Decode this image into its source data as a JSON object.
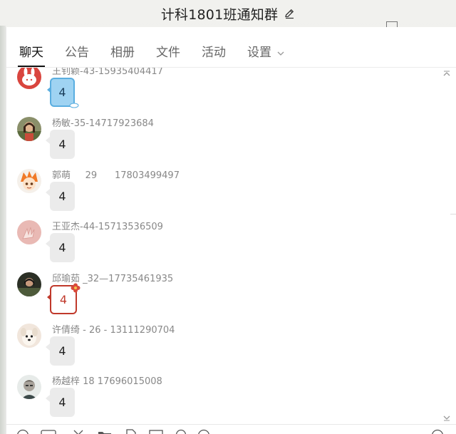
{
  "window": {
    "title": "计科1801班通知群"
  },
  "tabs": [
    {
      "label": "聊天",
      "active": true
    },
    {
      "label": "公告"
    },
    {
      "label": "相册"
    },
    {
      "label": "文件"
    },
    {
      "label": "活动"
    },
    {
      "label": "设置"
    }
  ],
  "messages": [
    {
      "sender": "王钊颖-43-15935404417",
      "text": "4"
    },
    {
      "sender": "杨敏-35-14717923684",
      "text": "4"
    },
    {
      "sender": "郭萌     29      17803499497",
      "text": "4"
    },
    {
      "sender": "王亚杰-44-15713536509",
      "text": "4"
    },
    {
      "sender": "邱瑜茹 _32—17735461935",
      "text": "4"
    },
    {
      "sender": "许倩绮 - 26 - 13111290704",
      "text": "4"
    },
    {
      "sender": "杨越梓 18 17696015008",
      "text": "4"
    }
  ],
  "colors": {
    "accent_blue": "#5aaee0",
    "accent_red": "#c0392b",
    "bubble_grey": "#ebebeb"
  },
  "icons": {
    "title_edit": "pencil-icon",
    "settings_chevron": "chevron-down-icon",
    "scroll_up": "chevron-up-icon",
    "scroll_down": "chevron-down-icon",
    "toolbar": [
      "emoji-icon",
      "screenshot-icon",
      "scissors-icon",
      "folder-icon",
      "file-icon",
      "image-icon",
      "microphone-icon",
      "more-icon",
      "history-icon"
    ]
  }
}
